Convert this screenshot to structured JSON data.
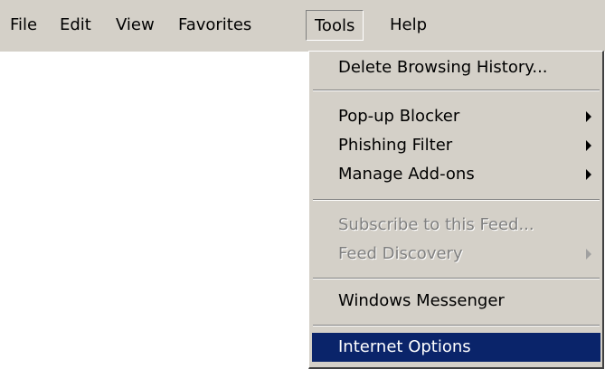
{
  "menubar": {
    "items": [
      {
        "label": "File"
      },
      {
        "label": "Edit"
      },
      {
        "label": "View"
      },
      {
        "label": "Favorites"
      },
      {
        "label": "Tools"
      },
      {
        "label": "Help"
      }
    ]
  },
  "tools_menu": {
    "items": [
      {
        "label": "Delete Browsing History..."
      },
      {
        "label": "Pop-up Blocker"
      },
      {
        "label": "Phishing Filter"
      },
      {
        "label": "Manage Add-ons"
      },
      {
        "label": "Subscribe to this Feed..."
      },
      {
        "label": "Feed Discovery"
      },
      {
        "label": "Windows Messenger"
      },
      {
        "label": "Internet Options"
      }
    ]
  },
  "colors": {
    "menu_bg": "#d4d0c8",
    "highlight_bg": "#0a246a",
    "disabled_text": "#808080"
  }
}
